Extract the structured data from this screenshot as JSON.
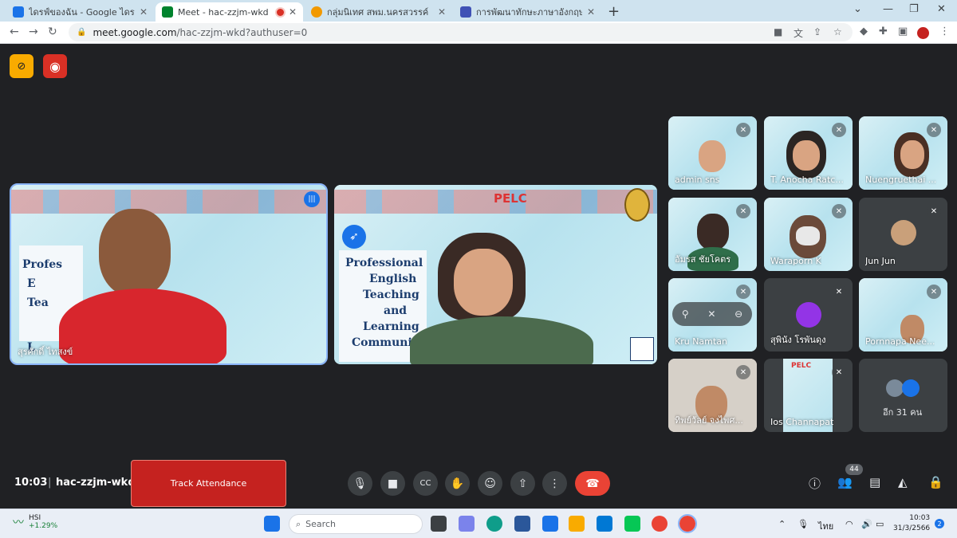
{
  "browser": {
    "tabs": [
      {
        "title": "ไดรฟ์ของฉัน - Google ไดรฟ์",
        "favicon_color": "#1a73e8",
        "active": false
      },
      {
        "title": "Meet - hac-zzjm-wkd",
        "favicon_color": "#00832d",
        "active": true,
        "recording": true
      },
      {
        "title": "กลุ่มนิเทศ สพม.นครสวรรค์",
        "favicon_color": "#f29900",
        "active": false
      },
      {
        "title": "การพัฒนาทักษะภาษาอังกฤษ English",
        "favicon_color": "#3f51b5",
        "active": false
      }
    ],
    "url_host": "meet.google.com",
    "url_path": "/hac-zzjm-wkd?authuser=0"
  },
  "meet": {
    "main_tiles": [
      {
        "name": "สุรศักดิ์ ไทสงข์",
        "slide_text": [
          "Profes",
          "E",
          "Tea",
          "L"
        ]
      },
      {
        "name": "",
        "slide_text": [
          "Professional",
          "English",
          "Teaching",
          "and",
          "Learning",
          "Community"
        ]
      }
    ],
    "pelc": "PELC",
    "grid_tiles": [
      {
        "name": "admin sns"
      },
      {
        "name": "T. Anocha Ratc..."
      },
      {
        "name": "Nuengruethai ..."
      },
      {
        "name": "อัมรส ชัยโคตร"
      },
      {
        "name": "Waraporn K"
      },
      {
        "name": "Jun Jun"
      },
      {
        "name": "Kru Namtan"
      },
      {
        "name": "สุพินัง โรพันดุง"
      },
      {
        "name": "Pornnapa Nee..."
      },
      {
        "name": "ทิพย์วัลย์ จงไพศ..."
      },
      {
        "name": "Ios Channapat"
      },
      {
        "name": "อีก 31 คน"
      }
    ],
    "bottom": {
      "time": "10:03",
      "meeting_code": "hac-zzjm-wkd",
      "track_button": "Track Attendance",
      "people_count": "44"
    },
    "colors": {
      "background": "#202124",
      "hangup": "#ea4335",
      "track": "#c5221f"
    }
  },
  "taskbar": {
    "stock_name": "HSI",
    "stock_change": "+1.29%",
    "search_placeholder": "Search",
    "lang": "ไทย",
    "time": "10:03",
    "date": "31/3/2566",
    "notifications": "2"
  }
}
